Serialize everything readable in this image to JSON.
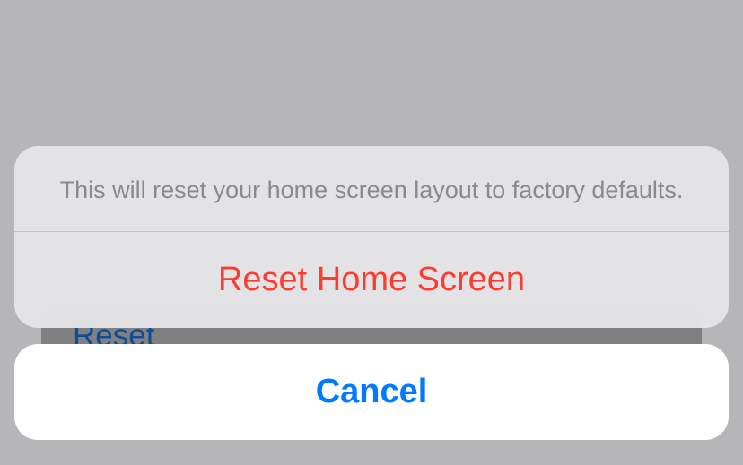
{
  "background": {
    "reset_text": "Reset"
  },
  "action_sheet": {
    "message": "This will reset your home screen layout to factory defaults.",
    "destructive_label": "Reset Home Screen",
    "cancel_label": "Cancel"
  }
}
